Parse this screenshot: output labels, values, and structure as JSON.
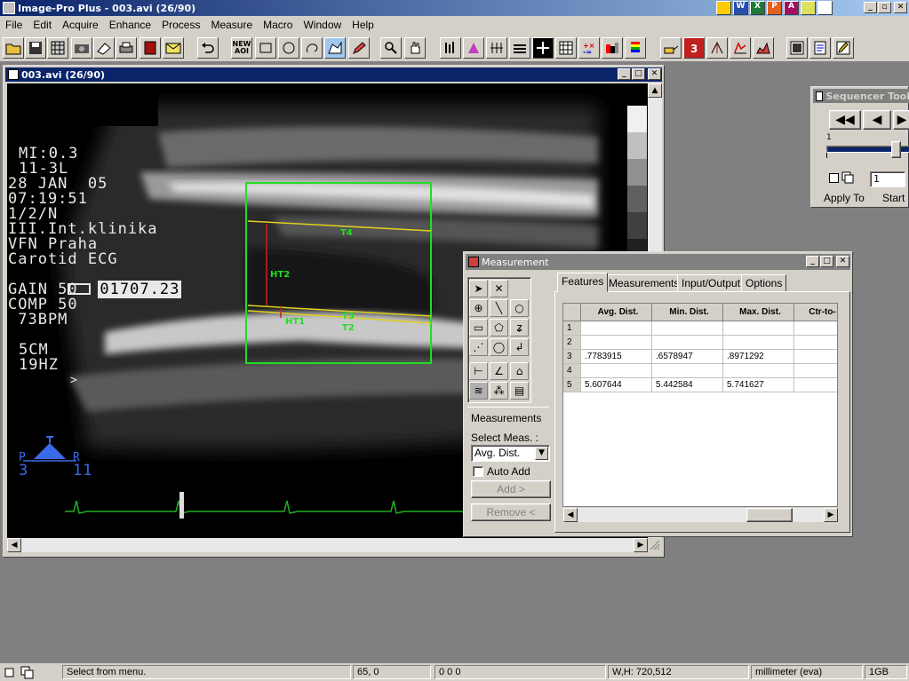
{
  "app": {
    "title": "Image-Pro Plus - 003.avi (26/90)"
  },
  "menu": [
    "File",
    "Edit",
    "Acquire",
    "Enhance",
    "Process",
    "Measure",
    "Macro",
    "Window",
    "Help"
  ],
  "image_window": {
    "title": "003.avi (26/90)",
    "overlay_lines": [
      "MI:0.3",
      "11-3L",
      "28 JAN  05",
      "07:19:51",
      "1/2/N",
      "III.Int.klinika",
      "VFN Praha",
      "Carotid ECG"
    ],
    "counter": "01707.23",
    "overlay_lines2": [
      "GAIN 50",
      "COMP 50",
      " 73BPM"
    ],
    "overlay_lines3": [
      "5CM",
      "19HZ"
    ],
    "probe_left": "P",
    "probe_right": "R",
    "probe_num_left": "3",
    "probe_num_right": "11",
    "arrow": ">",
    "labels": {
      "t4": "T4",
      "ht2": "HT2",
      "t3": "T3",
      "t2": "T2",
      "ht1": "HT1"
    }
  },
  "sequencer": {
    "title": "Sequencer Tool",
    "slider_min": "1",
    "apply_to": "Apply To",
    "start_label": "Start",
    "start_value": "1"
  },
  "measurement": {
    "title": "Measurement",
    "tabs": [
      "Features",
      "Measurements",
      "Input/Output",
      "Options"
    ],
    "measurements_label": "Measurements",
    "select_label": "Select Meas. :",
    "select_value": "Avg. Dist.",
    "auto_add": "Auto Add",
    "add_btn": "Add >",
    "remove_btn": "Remove <",
    "columns": [
      "Avg. Dist.",
      "Min. Dist.",
      "Max. Dist.",
      "Ctr-to-"
    ],
    "rows": [
      {
        "n": "1",
        "avg": "",
        "min": "",
        "max": ""
      },
      {
        "n": "2",
        "avg": "",
        "min": "",
        "max": ""
      },
      {
        "n": "3",
        "avg": ".7783915",
        "min": ".6578947",
        "max": ".8971292"
      },
      {
        "n": "4",
        "avg": "",
        "min": "",
        "max": ""
      },
      {
        "n": "5",
        "avg": "5.607644",
        "min": "5.442584",
        "max": "5.741627"
      }
    ]
  },
  "status": {
    "message": "Select from menu.",
    "coords": "65,  0",
    "rgb": "0  0  0",
    "wh": "W,H: 720,512",
    "unit": "millimeter (eva)",
    "mem": "1GB"
  },
  "colors": {
    "title_active": "#0a246a",
    "roi_green": "#22dd22",
    "line_yellow": "#e0d020",
    "line_red": "#cc2020"
  }
}
